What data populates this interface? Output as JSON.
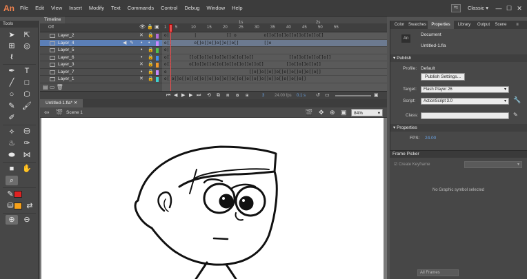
{
  "app": {
    "logo": "An"
  },
  "menu": [
    "File",
    "Edit",
    "View",
    "Insert",
    "Modify",
    "Text",
    "Commands",
    "Control",
    "Debug",
    "Window",
    "Help"
  ],
  "workspace": {
    "label": "Classic",
    "chevron": "▾"
  },
  "window_controls": {
    "minimize": "—",
    "maximize": "☐",
    "close": "✕"
  },
  "tools_panel": {
    "title": "Tools"
  },
  "timeline": {
    "tab": "Timeline",
    "header_label": "Off",
    "ruler_marks": [
      "1",
      "5",
      "10",
      "15",
      "20",
      "25",
      "30",
      "35",
      "40",
      "45",
      "50",
      "55"
    ],
    "seconds_marks": [
      "1s",
      "2s"
    ],
    "layers": [
      {
        "name": "Layer_2",
        "frames": "o|          |            [] o           o[]o[]o[]o[]o[]o[]o[]o[]",
        "color": "#b46cd6",
        "hidden": true
      },
      {
        "name": "Layer_4",
        "frames": "o[]         o[]o[]o[]o[]o[]o[]          []o",
        "color": "#c889ff",
        "selected": true
      },
      {
        "name": "Layer_5",
        "frames": "o|",
        "color": "#4ec04e"
      },
      {
        "name": "Layer_6",
        "frames": "o[]       []o[]o[]o[]o[]o[]o[]o[]o[]              []o[]o[]o[]o[]o[]",
        "color": "#3e8ef0"
      },
      {
        "name": "Layer_3",
        "frames": "o[]       o[]o[]o[]o[]o[]o[]o[]o[]o[]o[]         []o[]o[]o[]o[]",
        "color": "#f09a2a",
        "hidden": true
      },
      {
        "name": "Layer_7",
        "frames": "o                                 []o[]o[]o[]o[]o[]o[]o[]o[]o[]",
        "color": "#c889ff"
      },
      {
        "name": "Layer_1",
        "frames": "o[]o[]o[]o[]o[]o[]o[]o[]o[]o[]o[]o[]o[]o[]o[]o[]o[]o[]o[]",
        "color": "#3ed0d0",
        "hidden": true
      }
    ],
    "footer": {
      "current_frame": "3",
      "fps": "24.00 fps",
      "time": "0.1 s"
    }
  },
  "document": {
    "tab": "Untitled-1.fla*",
    "scene": "Scene 1",
    "zoom": "84%"
  },
  "right_panel": {
    "tabs": [
      "Color",
      "Swatches",
      "Properties",
      "Library",
      "Output",
      "Scene"
    ],
    "active_tab": "Properties",
    "doc_type": "Document",
    "doc_name": "Untitled-1.fla",
    "publish": {
      "section": "Publish",
      "profile_label": "Profile:",
      "profile_value": "Default",
      "settings_button": "Publish Settings...",
      "target_label": "Target:",
      "target_value": "Flash Player 26",
      "script_label": "Script:",
      "script_value": "ActionScript 3.0",
      "class_label": "Class:"
    },
    "properties": {
      "section": "Properties",
      "fps_label": "FPS:",
      "fps_value": "24.00"
    }
  },
  "frame_picker": {
    "title": "Frame Picker",
    "create_keyframe": "Create Keyframe",
    "empty_message": "No Graphic symbol selected",
    "all_frames": "All Frames"
  },
  "colors": {
    "stroke": "#e02222",
    "fill": "#f7a11a",
    "stage": "#ffffff",
    "accent": "#6aa5e8"
  }
}
